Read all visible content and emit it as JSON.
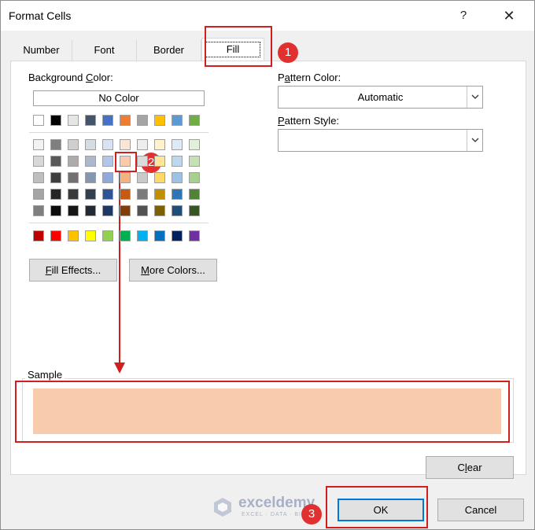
{
  "window": {
    "title": "Format Cells",
    "help": "?",
    "close": "✕"
  },
  "tabs": [
    {
      "label": "Number"
    },
    {
      "label": "Font"
    },
    {
      "label": "Border"
    },
    {
      "label": "Fill"
    }
  ],
  "fill": {
    "background_color_label_pre": "Background ",
    "background_color_label_u": "C",
    "background_color_label_post": "olor:",
    "no_color": "No Color",
    "theme_colors_row": [
      "#ffffff",
      "#000000",
      "#e7e6e6",
      "#44546a",
      "#4472c4",
      "#ed7d31",
      "#a5a5a5",
      "#ffc000",
      "#5b9bd5",
      "#70ad47"
    ],
    "tint_grid": [
      [
        "#f2f2f2",
        "#7f7f7f",
        "#d0cece",
        "#d6dce4",
        "#d9e2f3",
        "#fbe5d6",
        "#ededed",
        "#fff2cc",
        "#deebf6",
        "#e2efd9"
      ],
      [
        "#d8d8d8",
        "#595959",
        "#aeabab",
        "#adb9ca",
        "#b4c6e7",
        "#f8cbad",
        "#dbdbdb",
        "#fee599",
        "#bdd7ee",
        "#c5e0b3"
      ],
      [
        "#bfbfbf",
        "#3f3f3f",
        "#757070",
        "#8496b0",
        "#8eaadb",
        "#f4b183",
        "#c9c9c9",
        "#ffd965",
        "#9cc3e5",
        "#a8d08d"
      ],
      [
        "#a5a5a5",
        "#262626",
        "#3a3838",
        "#323f4f",
        "#2f5496",
        "#c55a11",
        "#7b7b7b",
        "#bf9000",
        "#2e75b5",
        "#538135"
      ],
      [
        "#7f7f7f",
        "#0c0c0c",
        "#171616",
        "#222a35",
        "#1f3864",
        "#833c0b",
        "#525252",
        "#7f6000",
        "#1e4e79",
        "#375623"
      ]
    ],
    "standard_colors": [
      "#c00000",
      "#ff0000",
      "#ffc000",
      "#ffff00",
      "#92d050",
      "#00b050",
      "#00b0f0",
      "#0070c0",
      "#002060",
      "#7030a0"
    ],
    "fill_effects_u": "F",
    "fill_effects_rest": "ill Effects...",
    "more_colors_u": "M",
    "more_colors_rest": "ore Colors...",
    "pattern_color_label_pre": "P",
    "pattern_color_label_u": "a",
    "pattern_color_label_post": "ttern Color:",
    "pattern_color_value": "Automatic",
    "pattern_style_label_pre": "",
    "pattern_style_label_u": "P",
    "pattern_style_label_post": "attern Style:",
    "pattern_style_value": "",
    "sample_label": "Sample",
    "sample_color": "#f8cbad",
    "clear_pre": "C",
    "clear_u": "l",
    "clear_post": "ear"
  },
  "footer": {
    "ok": "OK",
    "cancel": "Cancel"
  },
  "annotations": {
    "step1": "1",
    "step2": "2",
    "step3": "3"
  },
  "watermark": {
    "name": "exceldemy",
    "tagline": "EXCEL · DATA · BI"
  }
}
